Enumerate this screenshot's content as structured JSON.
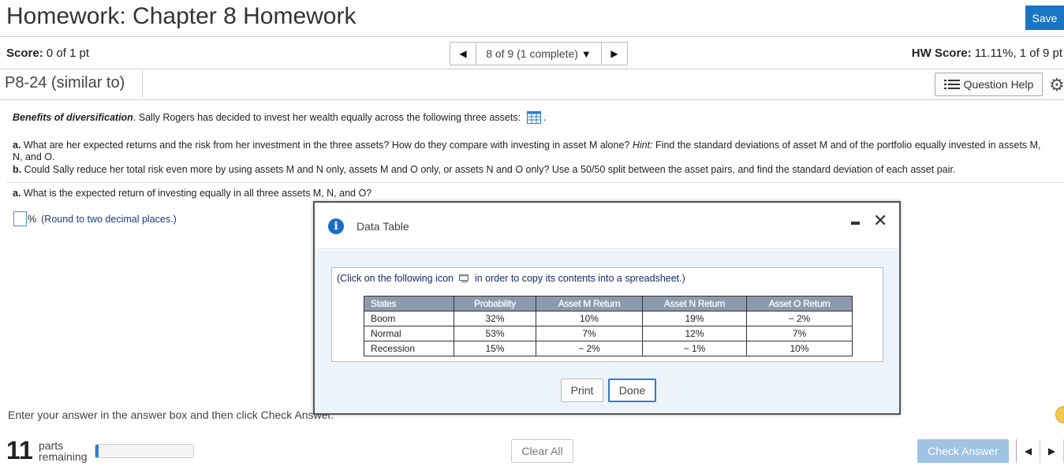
{
  "header": {
    "title": "Homework: Chapter 8 Homework",
    "save_label": "Save",
    "score_label": "Score:",
    "score_value": "0 of 1 pt",
    "nav_label": "8 of 9 (1 complete)",
    "hw_score_label": "HW Score:",
    "hw_score_value": "11.11%, 1 of 9 pt"
  },
  "problem": {
    "id": "P8-24 (similar to)",
    "question_help_label": "Question Help",
    "intro_bold": "Benefits of diversification",
    "intro_text": ". Sally Rogers has decided to invest her wealth equally across the following three assets:",
    "part_a_label": "a.",
    "part_a_text": "What are her expected returns and the risk from her investment in the three assets? How do they compare with investing in asset M alone?",
    "hint_label": "Hint:",
    "hint_text": "Find the standard deviations of asset M and of the portfolio equally invested in",
    "part_a_cont": "assets M, N, and O.",
    "part_b_label": "b.",
    "part_b_text": "Could Sally reduce her total risk even more by using assets M and N only, assets M and O only, or assets N and O only? Use a 50/50 split between the asset pairs, and find the standard deviation of each asset pair.",
    "question_label": "a.",
    "question_text": "What is the expected return of investing equally in all three assets M, N, and O?",
    "answer_unit": "%",
    "answer_hint": "(Round to two decimal places.)"
  },
  "footer": {
    "instruction": "Enter your answer in the answer box and then click Check Answer.",
    "parts_count": "11",
    "parts_word": "parts",
    "parts_remaining": "remaining",
    "progress_fraction": 0.03,
    "clear_all_label": "Clear All",
    "check_answer_label": "Check Answer"
  },
  "modal": {
    "title": "Data Table",
    "copy_text_before": "(Click on the following icon",
    "copy_text_after": "in order to copy its contents into a spreadsheet.)",
    "print_label": "Print",
    "done_label": "Done",
    "table": {
      "headers": [
        "States",
        "Probability",
        "Asset M Return",
        "Asset N Return",
        "Asset O Return"
      ],
      "rows": [
        [
          "Boom",
          "32%",
          "10%",
          "19%",
          "− 2%"
        ],
        [
          "Normal",
          "53%",
          "7%",
          "12%",
          "7%"
        ],
        [
          "Recession",
          "15%",
          "− 2%",
          "− 1%",
          "10%"
        ]
      ]
    }
  },
  "colors": {
    "accent": "#1a75c4",
    "header_cell": "#8d9aae",
    "modal_body": "#edf3fa",
    "check_disabled": "#9fc3e4"
  }
}
